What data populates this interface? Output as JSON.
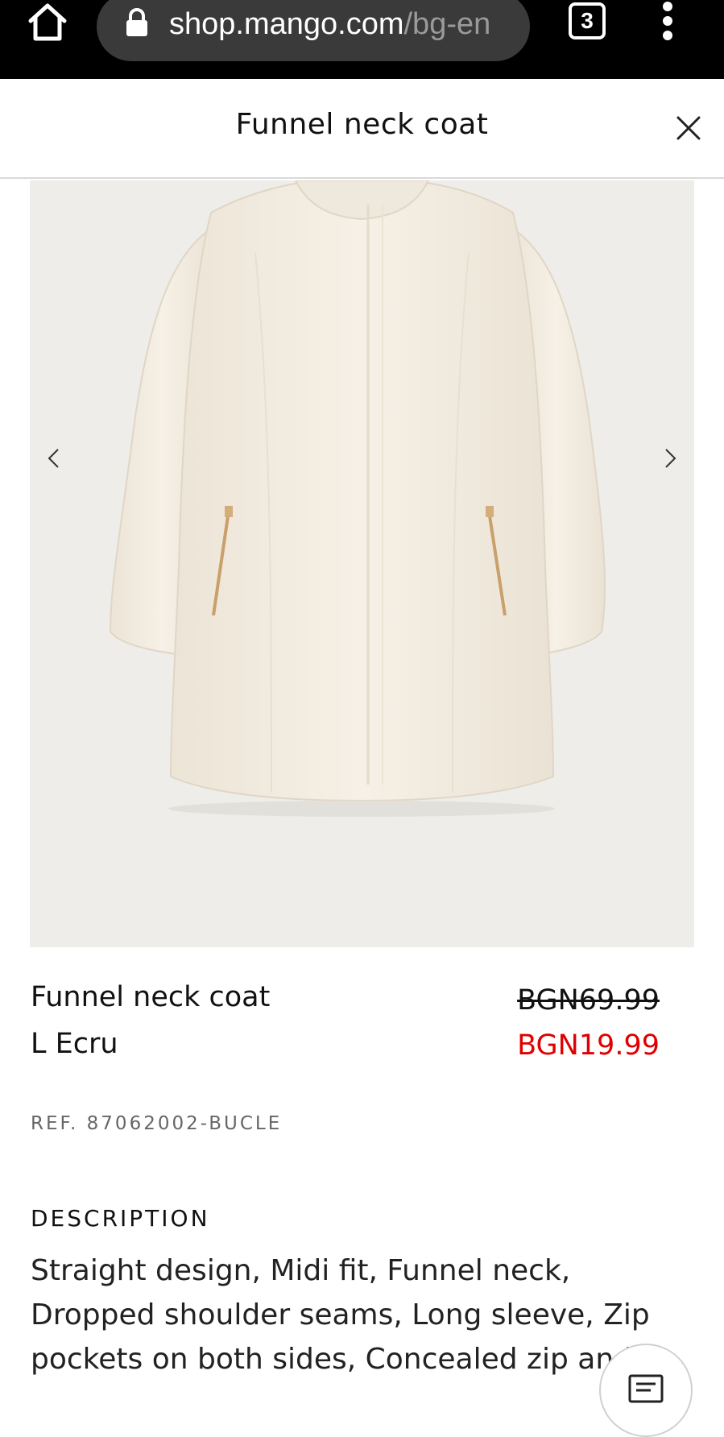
{
  "browser": {
    "url_host": "shop.mango.com",
    "url_path": "/bg-en",
    "tab_count": "3",
    "icons": [
      "home-icon",
      "lock-icon",
      "tabs-icon",
      "more-vert-icon"
    ]
  },
  "modal": {
    "title": "Funnel neck coat",
    "close_icon": "close-icon"
  },
  "product": {
    "image_alt": "Funnel neck coat",
    "name": "Funnel neck coat",
    "variant": "L Ecru",
    "price_original": "BGN69.99",
    "price_sale": "BGN19.99",
    "ref": "REF. 87062002-BUCLE",
    "description_heading": "DESCRIPTION",
    "description": "Straight design, Midi fit, Funnel neck, Dropped shoulder seams, Long sleeve, Zip pockets on both sides, Concealed zip and"
  },
  "colors": {
    "sale_price": "#e00000",
    "browser_bar": "#000000",
    "url_pill": "#3a3a3a",
    "image_bg": "#eeede9",
    "coat": "#f3ece0"
  }
}
